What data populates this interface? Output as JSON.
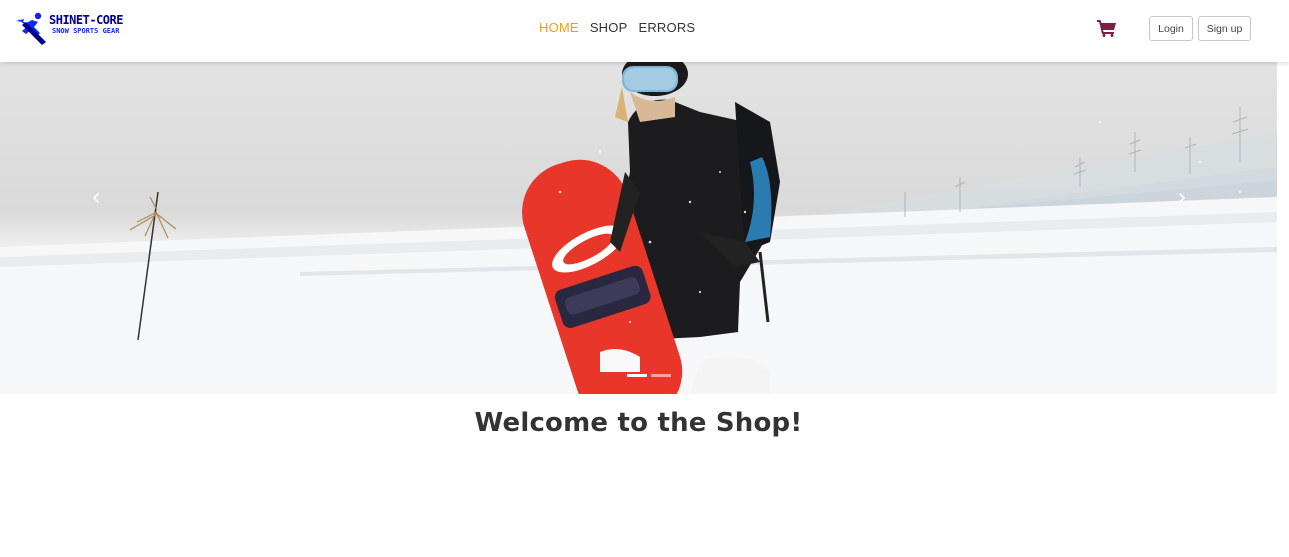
{
  "header": {
    "brand_line1": "SHINET-CORE",
    "brand_line2": "SNOW SPORTS GEAR",
    "nav": [
      {
        "label": "HOME",
        "active": true
      },
      {
        "label": "SHOP",
        "active": false
      },
      {
        "label": "ERRORS",
        "active": false
      }
    ],
    "cart_icon": "shopping-cart-icon",
    "login_label": "Login",
    "signup_label": "Sign up"
  },
  "carousel": {
    "prev_label": "‹",
    "next_label": "›",
    "slide_count": 2,
    "active_slide": 1
  },
  "main": {
    "welcome": "Welcome to the Shop!"
  },
  "colors": {
    "nav_active": "#f0a000",
    "cart": "#7a1f45",
    "brand": "#00008b"
  }
}
